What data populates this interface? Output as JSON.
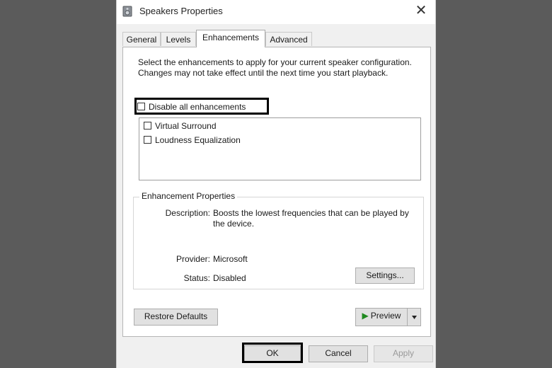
{
  "window": {
    "title": "Speakers Properties",
    "close_icon": "close-icon"
  },
  "tabs": [
    {
      "label": "General"
    },
    {
      "label": "Levels"
    },
    {
      "label": "Enhancements"
    },
    {
      "label": "Advanced"
    }
  ],
  "active_tab": "Enhancements",
  "instructions": "Select the enhancements to apply for your current speaker configuration. Changes may not take effect until the next time you start playback.",
  "disable_all": {
    "label": "Disable all enhancements",
    "checked": false
  },
  "enhancements": [
    {
      "label": "Virtual Surround",
      "checked": false
    },
    {
      "label": "Loudness Equalization",
      "checked": false
    }
  ],
  "properties": {
    "group_title": "Enhancement Properties",
    "description_label": "Description:",
    "description_value": "Boosts the lowest frequencies that can be played by the device.",
    "provider_label": "Provider:",
    "provider_value": "Microsoft",
    "status_label": "Status:",
    "status_value": "Disabled",
    "settings_button": "Settings..."
  },
  "restore_defaults": "Restore Defaults",
  "preview": {
    "label": "Preview",
    "play_icon": "play-icon",
    "dropdown_icon": "chevron-down-icon",
    "play_color": "#1f8a1f"
  },
  "footer": {
    "ok": "OK",
    "cancel": "Cancel",
    "apply": "Apply"
  },
  "colors": {
    "backdrop": "#5b5b5b",
    "dialog": "#f0f0f0",
    "panel": "#ffffff",
    "highlight": "#000000"
  }
}
